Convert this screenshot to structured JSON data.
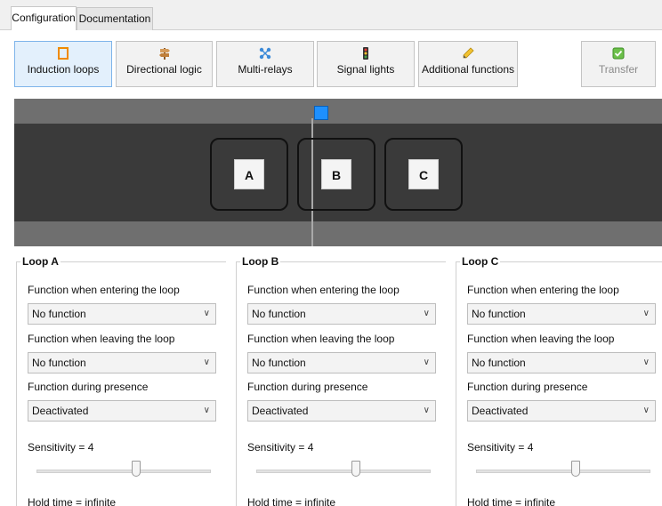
{
  "tabs": [
    {
      "label": "Configuration",
      "active": true
    },
    {
      "label": "Documentation",
      "active": false
    }
  ],
  "toolbar": {
    "buttons": [
      {
        "label": "Induction loops",
        "icon": "square-icon",
        "active": true
      },
      {
        "label": "Directional logic",
        "icon": "signpost-icon",
        "active": false
      },
      {
        "label": "Multi-relays",
        "icon": "relay-icon",
        "active": false
      },
      {
        "label": "Signal lights",
        "icon": "traffic-light-icon",
        "active": false
      },
      {
        "label": "Additional functions",
        "icon": "pencil-icon",
        "active": false
      }
    ],
    "transfer": {
      "label": "Transfer",
      "icon": "check-icon",
      "enabled": false
    }
  },
  "road": {
    "loops": [
      "A",
      "B",
      "C"
    ]
  },
  "panels": [
    {
      "title": "Loop A",
      "entering_label": "Function when entering the loop",
      "entering_value": "No function",
      "leaving_label": "Function when leaving the loop",
      "leaving_value": "No function",
      "presence_label": "Function during presence",
      "presence_value": "Deactivated",
      "sensitivity_text": "Sensitivity = 4",
      "sensitivity_level": 0.57,
      "hold_text": "Hold time = infinite"
    },
    {
      "title": "Loop B",
      "entering_label": "Function when entering the loop",
      "entering_value": "No function",
      "leaving_label": "Function when leaving the loop",
      "leaving_value": "No function",
      "presence_label": "Function during presence",
      "presence_value": "Deactivated",
      "sensitivity_text": "Sensitivity = 4",
      "sensitivity_level": 0.57,
      "hold_text": "Hold time = infinite"
    },
    {
      "title": "Loop C",
      "entering_label": "Function when entering the loop",
      "entering_value": "No function",
      "leaving_label": "Function when leaving the loop",
      "leaving_value": "No function",
      "presence_label": "Function during presence",
      "presence_value": "Deactivated",
      "sensitivity_text": "Sensitivity = 4",
      "sensitivity_level": 0.57,
      "hold_text": "Hold time = infinite"
    }
  ],
  "colors": {
    "accent": "#1e90ff",
    "road_outer": "#6f6f6f",
    "road_inner": "#3a3a3a"
  }
}
